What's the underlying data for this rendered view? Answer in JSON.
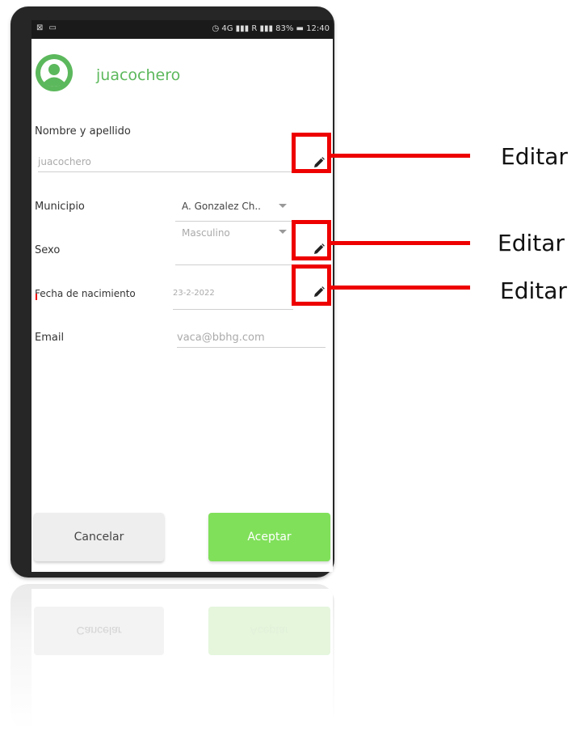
{
  "status_bar": {
    "left_icons": "⊠ ▭",
    "right_text": "◷ 4G ▮▮▮ R ▮▮▮ 83% ▬ 12:40"
  },
  "profile": {
    "username": "juacochero",
    "avatar_icon": "user-avatar-icon",
    "accent_color": "#5cb85c"
  },
  "form": {
    "name": {
      "label": "Nombre y apellido",
      "value": "juacochero"
    },
    "municipio": {
      "label": "Municipio",
      "value": "A. Gonzalez Ch.."
    },
    "sexo": {
      "label": "Sexo",
      "value": "Masculino"
    },
    "fecha": {
      "label": "Fecha de nacimiento",
      "value": "23-2-2022"
    },
    "email": {
      "label": "Email",
      "value": "vaca@bbhg.com"
    }
  },
  "buttons": {
    "cancel": "Cancelar",
    "accept": "Aceptar",
    "accept_color": "#80e05a"
  },
  "reflection": {
    "cancel": "Cancelar",
    "accept": "Aceptar"
  },
  "callouts": {
    "edit1": "Editar",
    "edit2": "Editar",
    "edit3": "Editar",
    "highlight_color": "#ee0000"
  }
}
